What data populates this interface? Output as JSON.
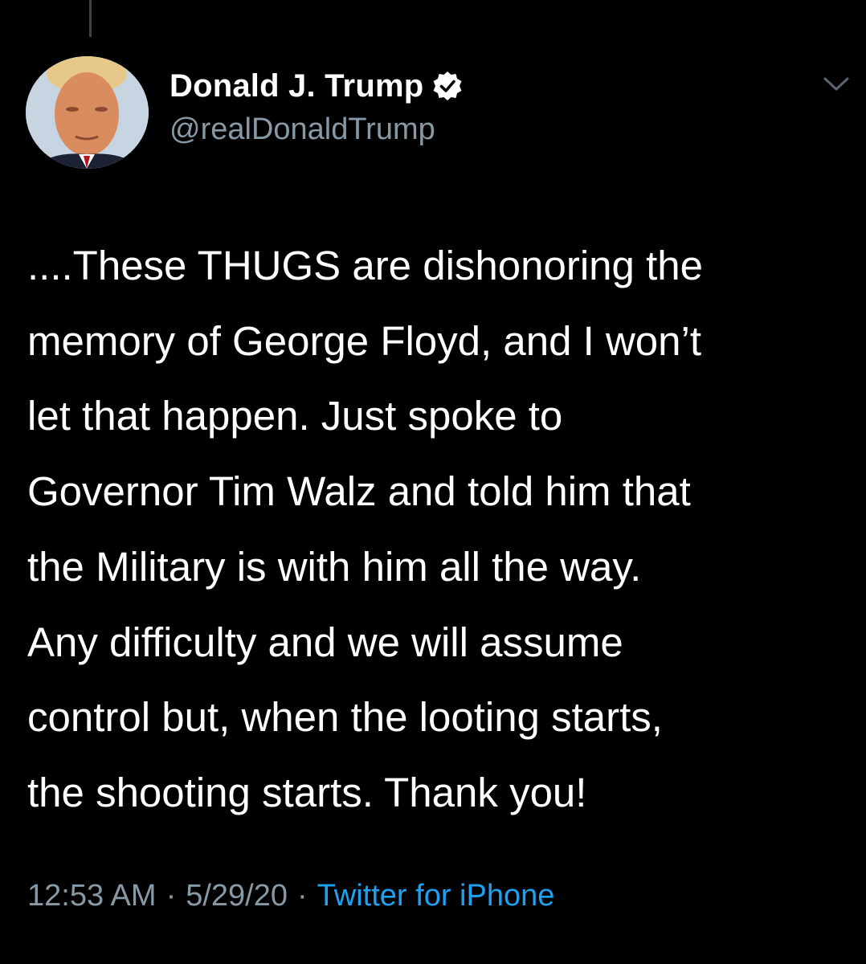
{
  "user": {
    "display_name": "Donald J. Trump",
    "handle": "@realDonaldTrump",
    "verified": true,
    "avatar_icon": "profile-photo"
  },
  "tweet": {
    "lines": [
      "....These THUGS are dishonoring the",
      "memory of George Floyd, and I won’t",
      "let that happen. Just spoke to",
      "Governor Tim Walz and told him that",
      "the Military is with him all the way.",
      "Any difficulty and we will assume",
      "control but, when the looting starts,",
      "the shooting starts. Thank you!"
    ]
  },
  "meta": {
    "time": "12:53 AM",
    "separator": "·",
    "date": "5/29/20",
    "source": "Twitter for iPhone"
  },
  "colors": {
    "background": "#000000",
    "text": "#ffffff",
    "secondary": "#8899a6",
    "link": "#1da1f2"
  }
}
